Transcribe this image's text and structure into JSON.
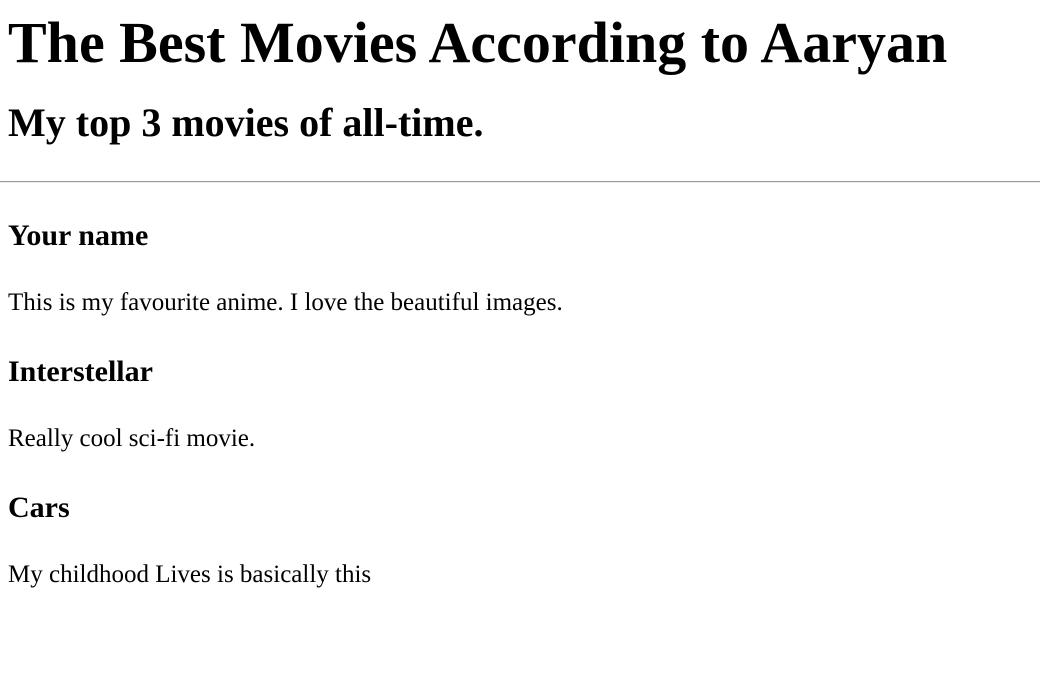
{
  "page": {
    "title": "The Best Movies According to Aaryan",
    "subtitle": "My top 3 movies of all-time."
  },
  "movies": [
    {
      "name": "Your name",
      "description": "This is my favourite anime. I love the beautiful images."
    },
    {
      "name": "Interstellar",
      "description": "Really cool sci-fi movie."
    },
    {
      "name": "Cars",
      "description": "My childhood Lives is basically this"
    }
  ]
}
